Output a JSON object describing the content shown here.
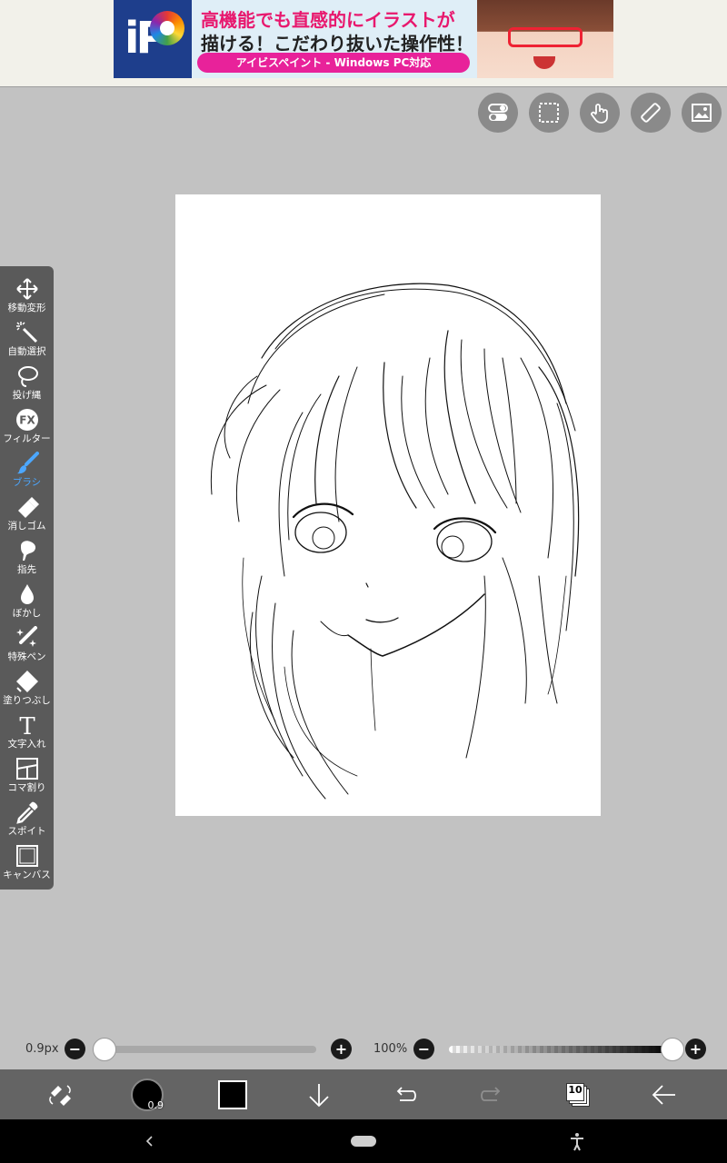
{
  "ad": {
    "headline": "高機能でも直感的にイラストが",
    "subline": "描ける！こだわり抜いた操作性！",
    "pill": "アイビスペイント - Windows PC対応",
    "logo_text": "iP"
  },
  "top_tools": [
    {
      "name": "toggle-icon"
    },
    {
      "name": "selection-icon"
    },
    {
      "name": "gesture-icon"
    },
    {
      "name": "ruler-icon"
    },
    {
      "name": "reference-image-icon"
    }
  ],
  "tools": [
    {
      "label": "移動変形",
      "icon": "move-icon"
    },
    {
      "label": "自動選択",
      "icon": "magic-wand-icon"
    },
    {
      "label": "投げ縄",
      "icon": "lasso-icon"
    },
    {
      "label": "フィルター",
      "icon": "fx-icon"
    },
    {
      "label": "ブラシ",
      "icon": "brush-icon",
      "active": true
    },
    {
      "label": "消しゴム",
      "icon": "eraser-icon"
    },
    {
      "label": "指先",
      "icon": "finger-icon"
    },
    {
      "label": "ぼかし",
      "icon": "blur-drop-icon"
    },
    {
      "label": "特殊ペン",
      "icon": "special-pen-icon"
    },
    {
      "label": "塗りつぶし",
      "icon": "fill-icon"
    },
    {
      "label": "文字入れ",
      "icon": "text-icon"
    },
    {
      "label": "コマ割り",
      "icon": "frame-divider-icon"
    },
    {
      "label": "スポイト",
      "icon": "eyedropper-icon"
    },
    {
      "label": "キャンバス",
      "icon": "canvas-icon"
    }
  ],
  "brush": {
    "size_label": "0.9px",
    "size_fraction": 0.02,
    "opacity_label": "100%",
    "opacity_fraction": 1.0,
    "minus": "−",
    "plus": "+"
  },
  "bottom": {
    "brush_size_badge": "0.9",
    "color": "#000000",
    "layer_count": "10"
  },
  "colors": {
    "active_tool": "#4ca7ff",
    "toolbar_bg": "#5a5a5a",
    "workspace_bg": "#c2c2c2"
  }
}
